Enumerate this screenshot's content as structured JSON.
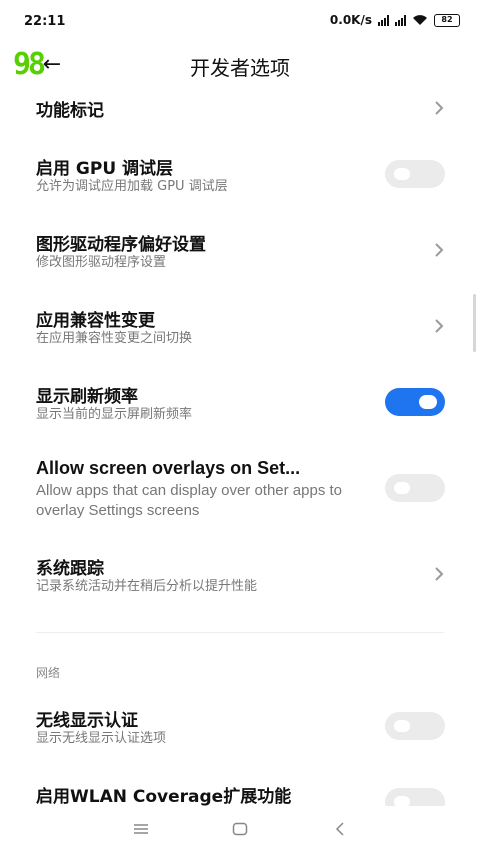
{
  "status_bar": {
    "time": "22:11",
    "speed": "0.0K/s",
    "battery": "82"
  },
  "header": {
    "logo": "98",
    "back_icon": "back-arrow-icon",
    "title": "开发者选项"
  },
  "settings": [
    {
      "title": "功能标记",
      "subtitle": "",
      "control": "chevron"
    },
    {
      "title": "启用 GPU 调试层",
      "subtitle": "允许为调试应用加载 GPU 调试层",
      "control": "toggle",
      "on": false
    },
    {
      "title": "图形驱动程序偏好设置",
      "subtitle": "修改图形驱动程序设置",
      "control": "chevron"
    },
    {
      "title": "应用兼容性变更",
      "subtitle": "在应用兼容性变更之间切换",
      "control": "chevron"
    },
    {
      "title": "显示刷新频率",
      "subtitle": "显示当前的显示屏刷新频率",
      "control": "toggle",
      "on": true
    },
    {
      "title": "Allow screen overlays on Set...",
      "subtitle": "Allow apps that can display over other apps to overlay Settings screens",
      "control": "toggle",
      "on": false
    },
    {
      "title": "系统跟踪",
      "subtitle": "记录系统活动并在稍后分析以提升性能",
      "control": "chevron"
    }
  ],
  "network_section": {
    "header": "网络",
    "items": [
      {
        "title": "无线显示认证",
        "subtitle": "显示无线显示认证选项",
        "control": "toggle",
        "on": false
      },
      {
        "title": "启用WLAN Coverage扩展功能",
        "subtitle": "",
        "control": "toggle",
        "on": false
      }
    ]
  },
  "nav_bar": {
    "icons": [
      "menu-icon",
      "home-icon",
      "back-icon"
    ]
  },
  "colors": {
    "accent": "#1f74f0",
    "logo": "#55d000",
    "toggle_off": "#ebebeb"
  }
}
